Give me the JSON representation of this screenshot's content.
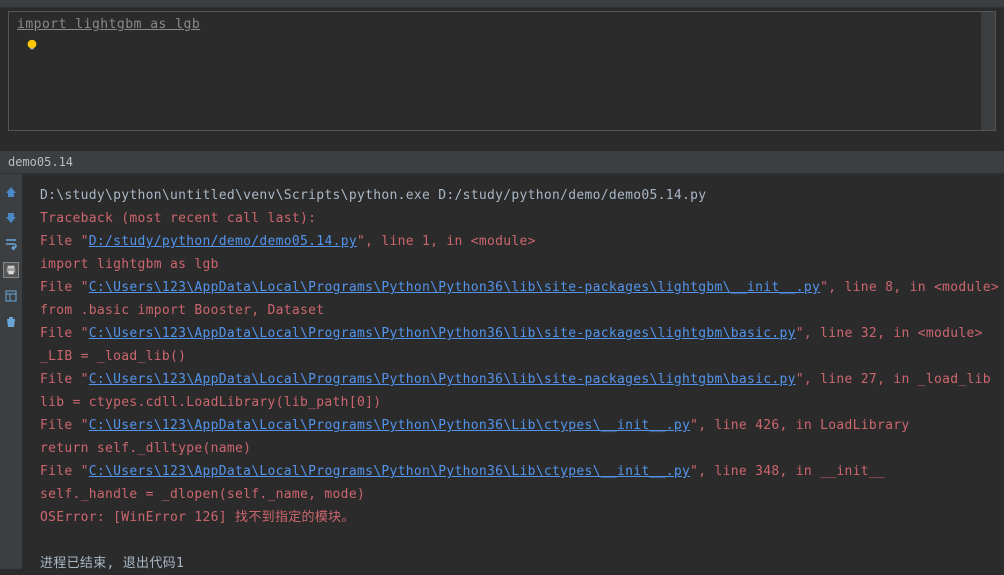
{
  "editor": {
    "code_line1": "import lightgbm as lgb"
  },
  "tab": {
    "label": "demo05.14"
  },
  "console": {
    "cmd": "D:\\study\\python\\untitled\\venv\\Scripts\\python.exe D:/study/python/demo/demo05.14.py",
    "traceback_header": "Traceback (most recent call last):",
    "f1_pre": "  File \"",
    "f1_link": "D:/study/python/demo/demo05.14.py",
    "f1_post": "\", line 1, in <module>",
    "f1_code": "    import lightgbm as lgb",
    "f2_pre": "  File \"",
    "f2_link": "C:\\Users\\123\\AppData\\Local\\Programs\\Python\\Python36\\lib\\site-packages\\lightgbm\\__init__.py",
    "f2_post": "\", line 8, in <module>",
    "f2_code": "    from .basic import Booster, Dataset",
    "f3_pre": "  File \"",
    "f3_link": "C:\\Users\\123\\AppData\\Local\\Programs\\Python\\Python36\\lib\\site-packages\\lightgbm\\basic.py",
    "f3_post": "\", line 32, in <module>",
    "f3_code": "    _LIB = _load_lib()",
    "f4_pre": "  File \"",
    "f4_link": "C:\\Users\\123\\AppData\\Local\\Programs\\Python\\Python36\\lib\\site-packages\\lightgbm\\basic.py",
    "f4_post": "\", line 27, in _load_lib",
    "f4_code": "    lib = ctypes.cdll.LoadLibrary(lib_path[0])",
    "f5_pre": "  File \"",
    "f5_link": "C:\\Users\\123\\AppData\\Local\\Programs\\Python\\Python36\\Lib\\ctypes\\__init__.py",
    "f5_post": "\", line 426, in LoadLibrary",
    "f5_code": "    return self._dlltype(name)",
    "f6_pre": "  File \"",
    "f6_link": "C:\\Users\\123\\AppData\\Local\\Programs\\Python\\Python36\\Lib\\ctypes\\__init__.py",
    "f6_post": "\", line 348, in __init__",
    "f6_code": "    self._handle = _dlopen(self._name, mode)",
    "oserror": "OSError: [WinError 126] 找不到指定的模块。",
    "exit": "进程已结束, 退出代码1"
  }
}
